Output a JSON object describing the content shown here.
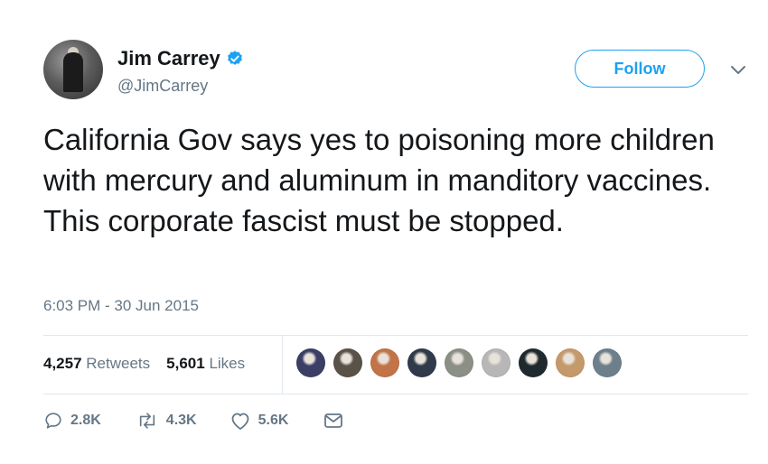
{
  "author": {
    "name": "Jim Carrey",
    "handle": "@JimCarrey",
    "verified": true
  },
  "follow_button": {
    "label": "Follow"
  },
  "tweet": {
    "text": "California Gov says yes to poisoning more children with mercury and aluminum in manditory vaccines. This corporate fascist must be stopped.",
    "timestamp": "6:03 PM - 30 Jun 2015"
  },
  "stats": {
    "retweets_count": "4,257",
    "retweets_label": "Retweets",
    "likes_count": "5,601",
    "likes_label": "Likes"
  },
  "liker_avatars": [
    {
      "color": "#3b3f66"
    },
    {
      "color": "#5a5148"
    },
    {
      "color": "#c17447"
    },
    {
      "color": "#2f3a4a"
    },
    {
      "color": "#8c8f86"
    },
    {
      "color": "#b7b7b7"
    },
    {
      "color": "#1f2a2e"
    },
    {
      "color": "#c49a6c"
    },
    {
      "color": "#6c7f8a"
    }
  ],
  "actions": {
    "reply_count": "2.8K",
    "retweet_count": "4.3K",
    "like_count": "5.6K",
    "icons": [
      "reply-icon",
      "retweet-icon",
      "heart-icon",
      "dm-icon"
    ]
  },
  "colors": {
    "accent": "#1da1f2",
    "text": "#14171a",
    "muted": "#657786",
    "divider": "#e1e8ed"
  }
}
